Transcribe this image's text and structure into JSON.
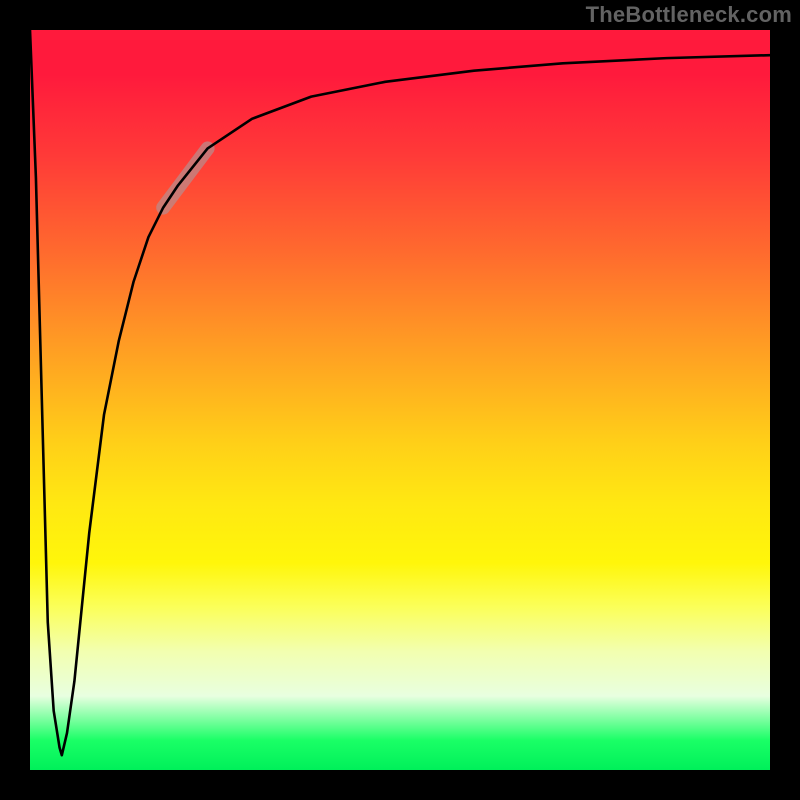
{
  "attribution": "TheBottleneck.com",
  "chart_data": {
    "type": "line",
    "title": "",
    "xlabel": "",
    "ylabel": "",
    "xlim": [
      0,
      100
    ],
    "ylim": [
      0,
      100
    ],
    "grid": false,
    "legend": false,
    "series": [
      {
        "name": "curve",
        "x": [
          0,
          0.8,
          1.6,
          2.4,
          3.2,
          4.0,
          4.3,
          5.0,
          6.0,
          7.0,
          8.0,
          10.0,
          12.0,
          14.0,
          16.0,
          18.0,
          20.0,
          24.0,
          30.0,
          38.0,
          48.0,
          60.0,
          72.0,
          86.0,
          100.0
        ],
        "y": [
          100,
          80,
          50,
          20,
          8,
          3,
          2,
          5,
          12,
          22,
          32,
          48,
          58,
          66,
          72,
          76,
          79,
          84,
          88,
          91,
          93,
          94.5,
          95.5,
          96.2,
          96.6
        ]
      }
    ],
    "highlight_segment": {
      "x_start": 18,
      "x_end": 24,
      "y_start": 76,
      "y_end": 84
    }
  },
  "colors": {
    "background": "#000000",
    "gradient_top": "#ff1a3c",
    "gradient_bottom": "#00f05a",
    "curve": "#000000",
    "highlight": "#bb8a8a",
    "attribution": "#636363"
  }
}
